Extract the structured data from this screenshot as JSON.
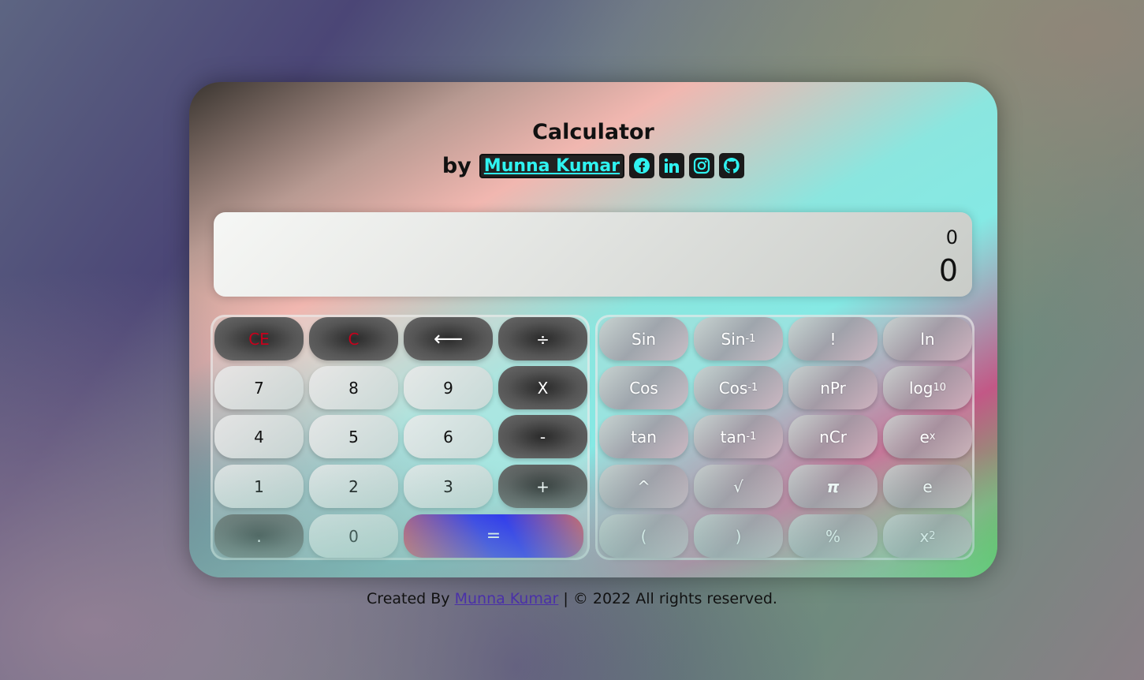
{
  "header": {
    "title": "Calculator",
    "by": "by",
    "author": "Munna Kumar",
    "social": [
      "facebook-icon",
      "linkedin-icon",
      "instagram-icon",
      "github-icon"
    ]
  },
  "display": {
    "previous": "0",
    "current": "0"
  },
  "basic": {
    "ce": "CE",
    "c": "C",
    "back": "⟵",
    "div": "÷",
    "n7": "7",
    "n8": "8",
    "n9": "9",
    "mul": "X",
    "n4": "4",
    "n5": "5",
    "n6": "6",
    "sub": "-",
    "n1": "1",
    "n2": "2",
    "n3": "3",
    "add": "+",
    "dot": ".",
    "n0": "0",
    "eq": "="
  },
  "sci": {
    "sin": "Sin",
    "asin_base": "Sin",
    "asin_sup": "-1",
    "fact": "!",
    "ln": "ln",
    "cos": "Cos",
    "acos_base": "Cos",
    "acos_sup": "-1",
    "npr": "nPr",
    "log_base": "log",
    "log_sub": "10",
    "tan": "tan",
    "atan_base": "tan",
    "atan_sup": "-1",
    "ncr": "nCr",
    "exp_base": "e",
    "exp_sup": "x",
    "pow": "^",
    "sqrt": "√",
    "pi": "π",
    "e": "e",
    "lp": "(",
    "rp": ")",
    "pct": "%",
    "sq_base": "x",
    "sq_sup": "2"
  },
  "footer": {
    "prefix": "Created By",
    "author": "Munna Kumar",
    "suffix": "| © 2022 All rights reserved."
  },
  "colors": {
    "accent": "#2ff2f0",
    "danger": "#c8001c"
  }
}
